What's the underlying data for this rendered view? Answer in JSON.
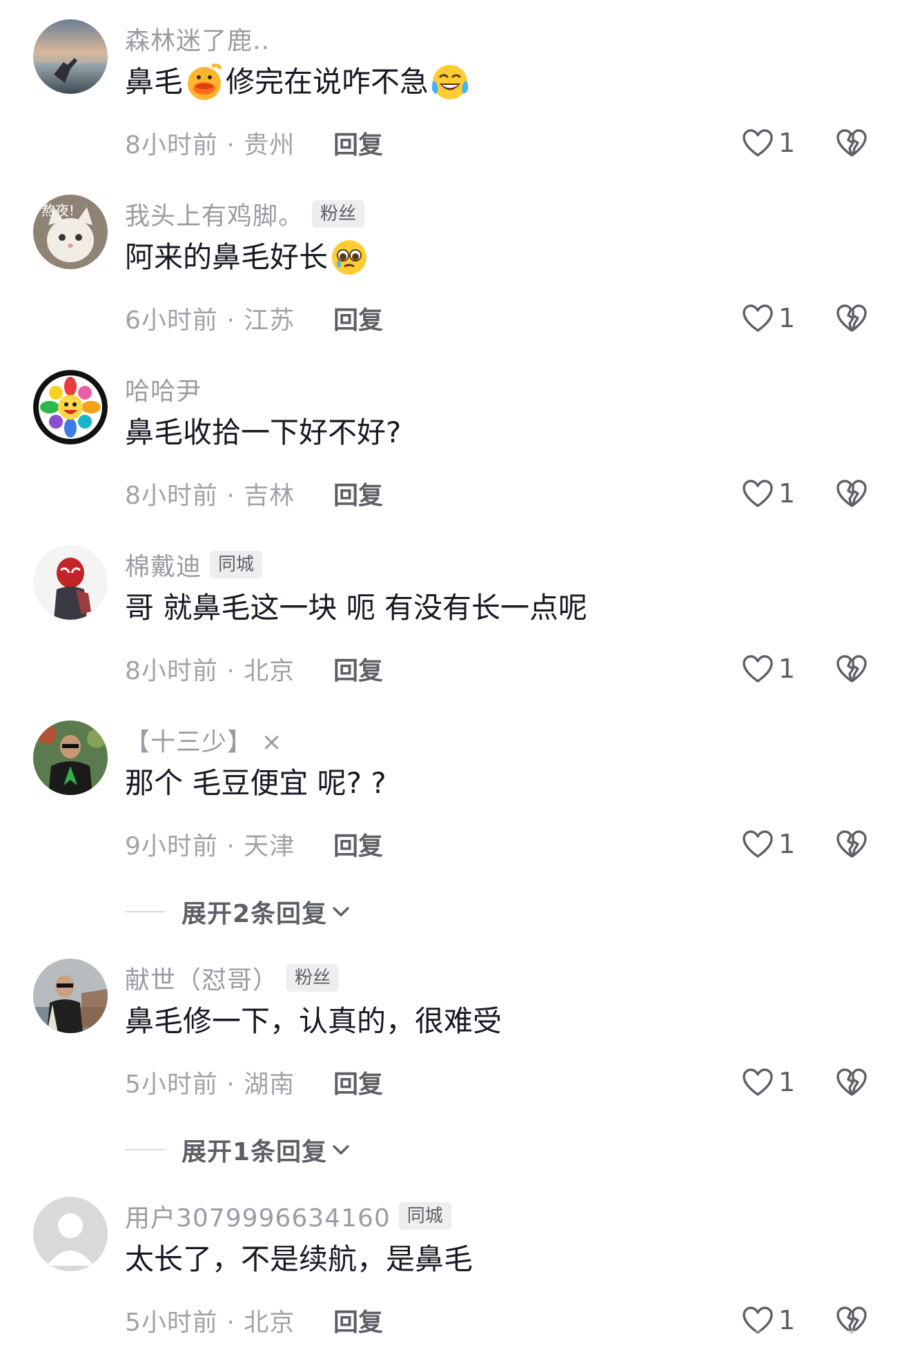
{
  "comments": [
    {
      "username": "森林迷了鹿..",
      "badge": "",
      "text_parts": [
        "鼻毛",
        "修完在说咋不急"
      ],
      "time_location": "8小时前 · 贵州",
      "reply_label": "回复",
      "like_count": "1",
      "avatar": "sunset-hand-avatar",
      "emojis": [
        "duck-emoji",
        "laughing-tears-emoji"
      ]
    },
    {
      "username": "我头上有鸡脚。",
      "badge": "粉丝",
      "text_parts": [
        "阿来的鼻毛好长"
      ],
      "time_location": "6小时前 · 江苏",
      "reply_label": "回复",
      "like_count": "1",
      "avatar": "cat-avatar",
      "avatar_caption": "熬夜!",
      "emojis": [
        "pleading-face-emoji"
      ]
    },
    {
      "username": "哈哈尹",
      "badge": "",
      "text_parts": [
        "鼻毛收拾一下好不好?"
      ],
      "time_location": "8小时前 · 吉林",
      "reply_label": "回复",
      "like_count": "1",
      "avatar": "rainbow-flower-avatar"
    },
    {
      "username": "棉戴迪",
      "badge": "同城",
      "text_parts": [
        "哥 就鼻毛这一块 呃 有没有长一点呢"
      ],
      "time_location": "8小时前 · 北京",
      "reply_label": "回复",
      "like_count": "1",
      "avatar": "spiderman-avatar"
    },
    {
      "username": "【十三少】 ×",
      "badge": "",
      "text_parts": [
        "那个 毛豆便宜 呢? ?"
      ],
      "time_location": "9小时前 · 天津",
      "reply_label": "回复",
      "like_count": "1",
      "avatar": "man-green-shirt-avatar",
      "expand_label": "展开2条回复"
    },
    {
      "username": "献世（怼哥）",
      "badge": "粉丝",
      "text_parts": [
        "鼻毛修一下，认真的，很难受"
      ],
      "time_location": "5小时前 · 湖南",
      "reply_label": "回复",
      "like_count": "1",
      "avatar": "man-sunglasses-avatar",
      "expand_label": "展开1条回复"
    },
    {
      "username": "用户3079996634160",
      "badge": "同城",
      "text_parts": [
        "太长了，不是续航，是鼻毛"
      ],
      "time_location": "5小时前 · 北京",
      "reply_label": "回复",
      "like_count": "1",
      "avatar": "default-user-avatar"
    }
  ]
}
